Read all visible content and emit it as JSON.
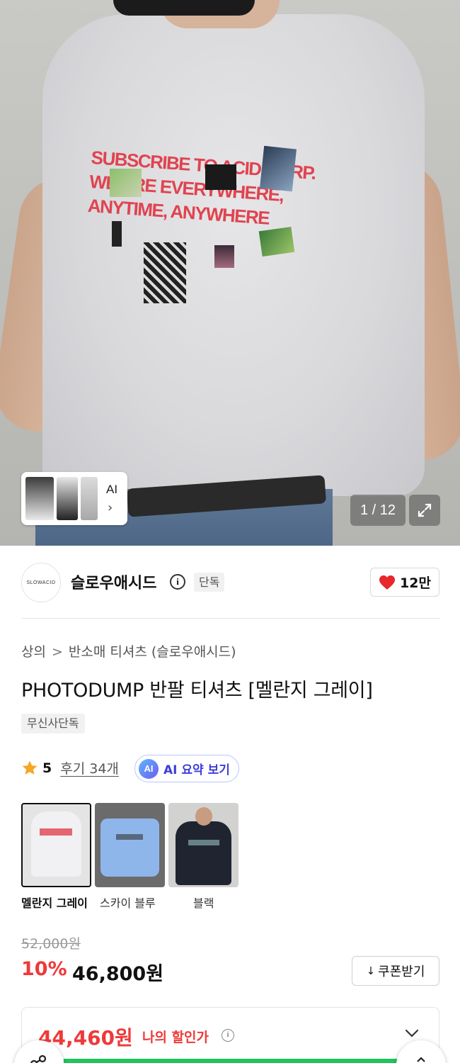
{
  "hero": {
    "print_lines": [
      "SUBSCRIBE TO ACID CORP.",
      "WE ARE EVERYWHERE,",
      "ANYTIME, ANYWHERE"
    ],
    "ai_label": "AI",
    "ai_chevron": "›",
    "image_counter": "1 / 12",
    "expand_icon": "expand-icon"
  },
  "brand": {
    "logo_text": "SLOWACID",
    "name": "슬로우애시드",
    "info_icon": "i",
    "exclusive_tag": "단독",
    "likes": "12만",
    "heart_color": "#e8262c"
  },
  "product": {
    "breadcrumb": [
      "상의",
      "반소매 티셔츠 (슬로우애시드)"
    ],
    "breadcrumb_sep": ">",
    "title": "PHOTODUMP 반팔 티셔츠 [멜란지 그레이]",
    "label": "무신사단독",
    "rating": "5",
    "reviews": "후기 34개",
    "ai_summary_badge": "AI",
    "ai_summary": "AI 요약 보기"
  },
  "colors": [
    {
      "label": "멜란지 그레이",
      "selected": true,
      "bg": "#d9d9dc"
    },
    {
      "label": "스카이 블루",
      "selected": false,
      "bg": "#8fb6ea"
    },
    {
      "label": "블랙",
      "selected": false,
      "bg": "#1f2430"
    }
  ],
  "price": {
    "original": "52,000원",
    "discount_rate": "10%",
    "sale": "46,800원",
    "coupon_button": "쿠폰받기",
    "coupon_icon": "↓",
    "my_price": "44,460원",
    "my_discount_label": "나의 할인가",
    "info_icon": "i",
    "progress": 1.0,
    "accent": "#ee3a3a"
  }
}
